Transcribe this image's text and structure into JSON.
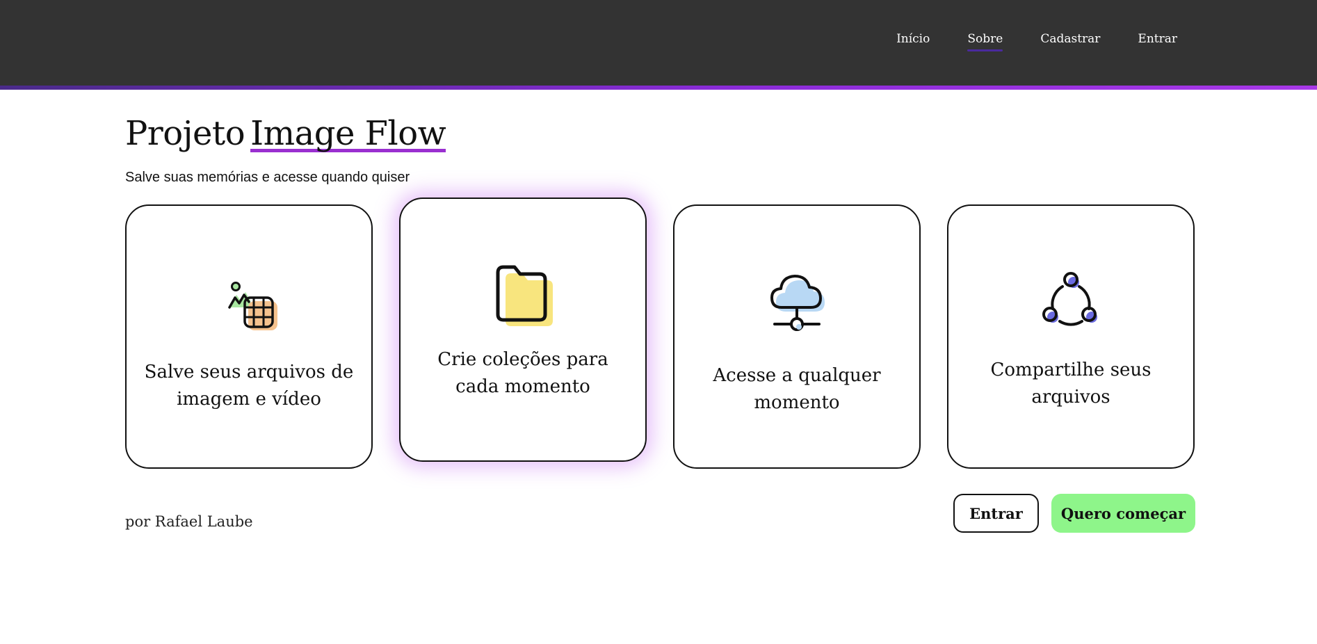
{
  "nav": {
    "items": [
      {
        "label": "Início",
        "active": false
      },
      {
        "label": "Sobre",
        "active": true
      },
      {
        "label": "Cadastrar",
        "active": false
      },
      {
        "label": "Entrar",
        "active": false
      }
    ]
  },
  "hero": {
    "title_prefix": "Projeto",
    "title_accent": "Image Flow",
    "subtitle": "Salve suas memórias e acesse quando quiser"
  },
  "cards": [
    {
      "icon": "image-video-icon",
      "text": "Salve seus arquivos de imagem e vídeo"
    },
    {
      "icon": "folder-icon",
      "text": "Crie coleções para cada momento"
    },
    {
      "icon": "cloud-network-icon",
      "text": "Acesse a qualquer momento"
    },
    {
      "icon": "share-icon",
      "text": "Compartilhe seus arquivos"
    }
  ],
  "footer": {
    "author": "por Rafael Laube",
    "login_label": "Entrar",
    "start_label": "Quero começar"
  },
  "colors": {
    "header_bg": "#333333",
    "accent_purple": "#9a2fd0",
    "cta_green": "#8ef58a"
  }
}
